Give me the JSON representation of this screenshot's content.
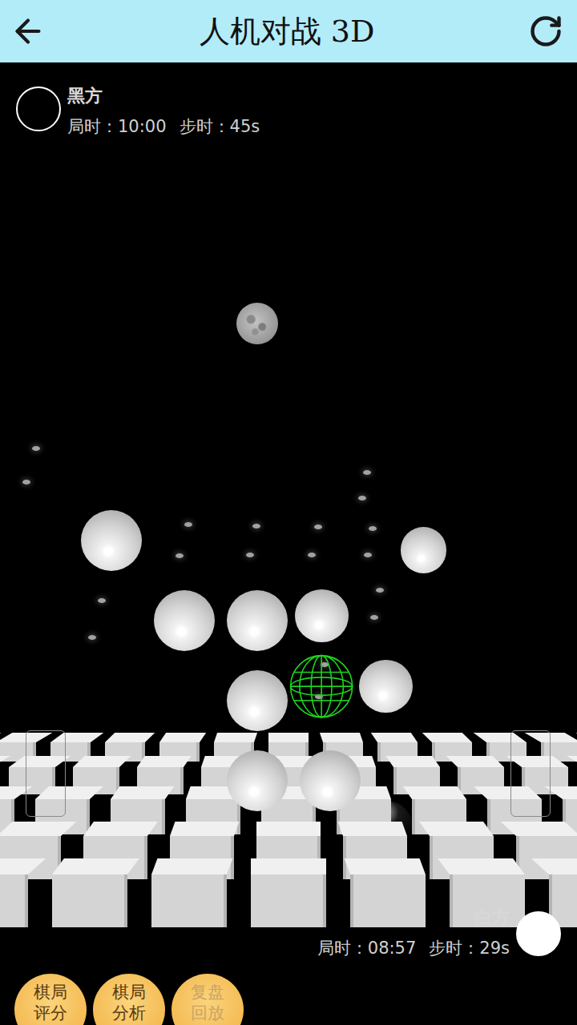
{
  "header": {
    "title": "人机对战 3D"
  },
  "players": [
    {
      "side": "black",
      "name": "黑方",
      "color": "#000000",
      "game_time": "局时：10:00",
      "move_time": "步时：45s"
    },
    {
      "side": "white",
      "name": "白方",
      "color": "#ffffff",
      "game_time": "局时：08:57",
      "move_time": "步时：29s"
    }
  ],
  "board": {
    "stones": [
      {
        "col": 1,
        "row": 3,
        "layer": 0,
        "color": "white"
      },
      {
        "col": 2,
        "row": 2,
        "layer": 0,
        "color": "white"
      },
      {
        "col": 3,
        "row": 2,
        "layer": 0,
        "color": "white"
      },
      {
        "col": 4,
        "row": 2,
        "layer": 1,
        "color": "white"
      },
      {
        "col": 3,
        "row": 1,
        "layer": 0,
        "color": "white"
      },
      {
        "col": 3,
        "row": 0,
        "layer": 0,
        "color": "white"
      },
      {
        "col": 4,
        "row": 0,
        "layer": 0,
        "color": "white"
      },
      {
        "col": 5,
        "row": 1,
        "layer": 1,
        "color": "white"
      },
      {
        "col": 6,
        "row": 3,
        "layer": 2,
        "color": "white"
      },
      {
        "col": 5,
        "row": -1,
        "layer": 1,
        "color": "black"
      }
    ],
    "cursor": {
      "col": 4,
      "row": 1,
      "layer": 1
    }
  },
  "buttons": [
    {
      "label": "棋局评分",
      "disabled": false
    },
    {
      "label": "棋局分析",
      "disabled": false
    },
    {
      "label": "复盘回放",
      "disabled": true
    }
  ]
}
